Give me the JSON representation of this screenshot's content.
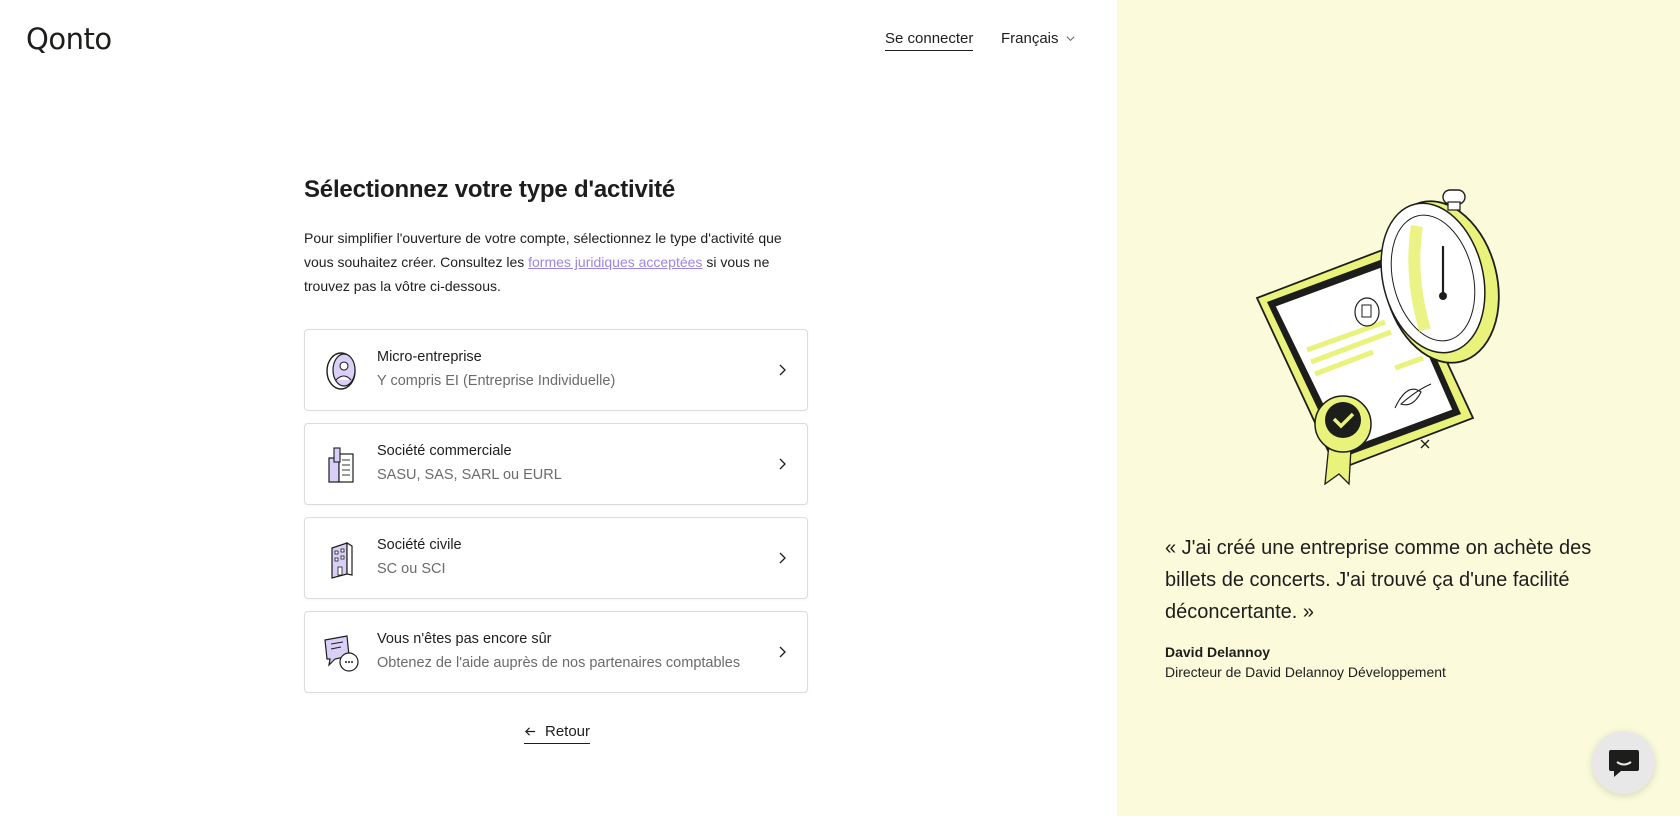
{
  "header": {
    "logo": "Qonto",
    "login_label": "Se connecter",
    "language_label": "Français"
  },
  "main": {
    "title": "Sélectionnez votre type d'activité",
    "intro_before": "Pour simplifier l'ouverture de votre compte, sélectionnez le type d'activité que vous souhaitez créer. Consultez les ",
    "intro_link": "formes juridiques acceptées",
    "intro_after": " si vous ne trouvez pas la vôtre ci-dessous.",
    "options": [
      {
        "title": "Micro-entreprise",
        "subtitle": "Y compris EI (Entreprise Individuelle)",
        "icon": "micro-business-icon"
      },
      {
        "title": "Société commerciale",
        "subtitle": "SASU, SAS, SARL ou EURL",
        "icon": "commercial-company-icon"
      },
      {
        "title": "Société civile",
        "subtitle": "SC ou SCI",
        "icon": "building-icon"
      },
      {
        "title": "Vous n'êtes pas encore sûr",
        "subtitle": "Obtenez de l'aide auprès de nos partenaires comptables",
        "icon": "chat-help-icon"
      }
    ],
    "back_label": "Retour"
  },
  "aside": {
    "quote": "« J'ai créé une entreprise comme on achète des billets de concerts. J'ai trouvé ça d'une facilité déconcertante. »",
    "author": "David Delannoy",
    "role": "Directeur de David Delannoy Développement"
  },
  "colors": {
    "accent_purple": "#9a86e8",
    "aside_background": "#fbfbdc",
    "illustration_yellow": "#e9f27a",
    "text": "#1d1d1b"
  }
}
